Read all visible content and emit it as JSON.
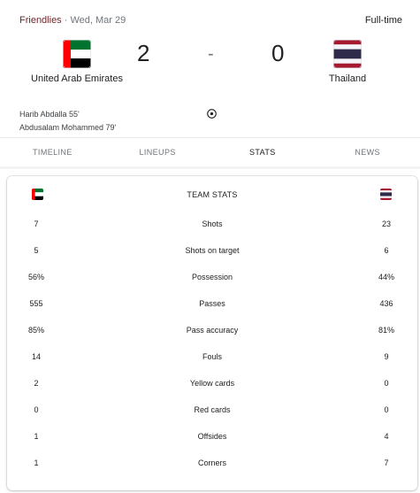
{
  "header": {
    "competition": "Friendlies",
    "separator": "·",
    "date": "Wed, Mar 29",
    "status": "Full-time"
  },
  "teams": {
    "home": {
      "name": "United Arab Emirates",
      "score": "2",
      "flag_colors": [
        "#00732f",
        "#ffffff",
        "#000000",
        "#ff0000"
      ]
    },
    "away": {
      "name": "Thailand",
      "score": "0",
      "flag_colors": [
        "#a51931",
        "#f4f5f8",
        "#2d2a4a"
      ]
    },
    "score_separator": "-"
  },
  "scorers": {
    "home": [
      "Harib Abdalla 55'",
      "Abdusalam Mohammed 79'"
    ],
    "icon": "soccer-ball-icon"
  },
  "tabs": [
    {
      "label": "TIMELINE",
      "active": false
    },
    {
      "label": "LINEUPS",
      "active": false
    },
    {
      "label": "STATS",
      "active": true
    },
    {
      "label": "NEWS",
      "active": false
    }
  ],
  "stats": {
    "title": "TEAM STATS",
    "rows": [
      {
        "label": "Shots",
        "home": "7",
        "away": "23"
      },
      {
        "label": "Shots on target",
        "home": "5",
        "away": "6"
      },
      {
        "label": "Possession",
        "home": "56%",
        "away": "44%"
      },
      {
        "label": "Passes",
        "home": "555",
        "away": "436"
      },
      {
        "label": "Pass accuracy",
        "home": "85%",
        "away": "81%"
      },
      {
        "label": "Fouls",
        "home": "14",
        "away": "9"
      },
      {
        "label": "Yellow cards",
        "home": "2",
        "away": "0"
      },
      {
        "label": "Red cards",
        "home": "0",
        "away": "0"
      },
      {
        "label": "Offsides",
        "home": "1",
        "away": "4"
      },
      {
        "label": "Corners",
        "home": "1",
        "away": "7"
      }
    ]
  },
  "colors": {
    "competition_link": "#70242a",
    "muted_text": "#70757a"
  }
}
